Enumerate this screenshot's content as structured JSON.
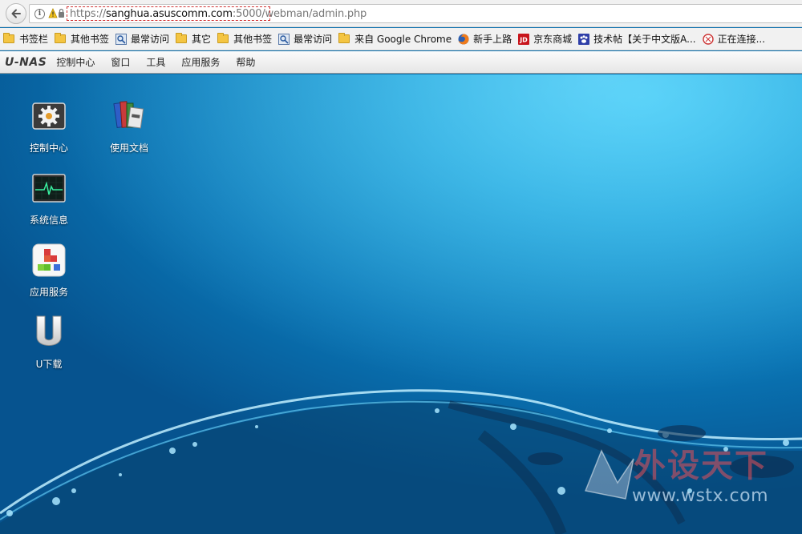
{
  "browser": {
    "url_scheme": "https://",
    "url_host": "sanghua.asuscomm.com",
    "url_rest": ":5000/webman/admin.php"
  },
  "bookmarks": [
    {
      "label": "书签栏",
      "icon": "folder-icon"
    },
    {
      "label": "其他书签",
      "icon": "folder-icon"
    },
    {
      "label": "最常访问",
      "icon": "most-visited-icon"
    },
    {
      "label": "其它",
      "icon": "folder-icon"
    },
    {
      "label": "其他书签",
      "icon": "folder-icon"
    },
    {
      "label": "最常访问",
      "icon": "most-visited-icon"
    },
    {
      "label": "来自 Google Chrome",
      "icon": "folder-icon"
    },
    {
      "label": "新手上路",
      "icon": "firefox-icon"
    },
    {
      "label": "京东商城",
      "icon": "jd-icon"
    },
    {
      "label": "技术帖【关于中文版A...",
      "icon": "paw-icon"
    },
    {
      "label": "正在连接...",
      "icon": "loading-icon"
    }
  ],
  "app": {
    "logo": "U-NAS",
    "menu": [
      "控制中心",
      "窗口",
      "工具",
      "应用服务",
      "帮助"
    ]
  },
  "desktop_icons": {
    "control_center": "控制中心",
    "docs": "使用文档",
    "sysinfo": "系统信息",
    "app_service": "应用服务",
    "u_download": "U下载"
  },
  "watermark": {
    "title": "外设天下",
    "site": "www.wstx.com"
  },
  "colors": {
    "desktop_blue": "#0a78b8",
    "url_highlight": "#d03030"
  }
}
